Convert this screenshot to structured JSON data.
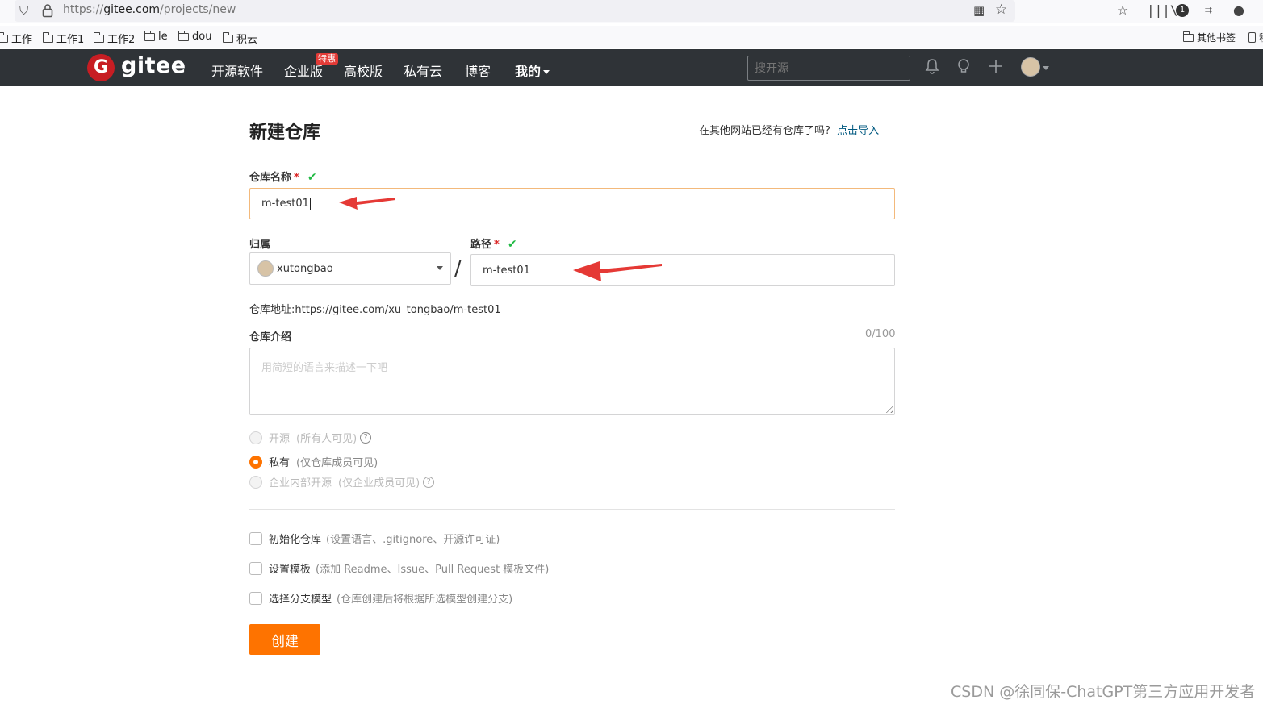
{
  "browser": {
    "url_prefix": "https://",
    "url_host": "gitee.com",
    "url_path": "/projects/new",
    "bookmarks": [
      "工作",
      "工作1",
      "工作2",
      "le",
      "dou",
      "积云"
    ],
    "other_bookmarks": "其他书签",
    "mobile_bookmarks": "移"
  },
  "navbar": {
    "logo_letter": "G",
    "logo_text": "gitee",
    "items": [
      "开源软件",
      "企业版",
      "高校版",
      "私有云",
      "博客",
      "我的"
    ],
    "enterprise_badge": "特惠",
    "search_placeholder": "搜开源"
  },
  "page": {
    "title": "新建仓库",
    "import_question": "在其他网站已经有仓库了吗?",
    "import_link": "点击导入"
  },
  "form": {
    "name_label": "仓库名称",
    "required_mark": "*",
    "check_mark": "✔",
    "name_value": "m-test01",
    "owner_label": "归属",
    "owner_value": "xutongbao",
    "separator": "/",
    "path_label": "路径",
    "path_value": "m-test01",
    "address_label": "仓库地址:",
    "address_value": "https://gitee.com/xu_tongbao/m-test01",
    "intro_label": "仓库介绍",
    "intro_counter": "0/100",
    "intro_placeholder": "用简短的语言来描述一下吧",
    "visibility": [
      {
        "label": "开源",
        "hint": "(所有人可见)",
        "checked": false,
        "disabled": true
      },
      {
        "label": "私有",
        "hint": "(仅仓库成员可见)",
        "checked": true,
        "disabled": false
      },
      {
        "label": "企业内部开源",
        "hint": "(仅企业成员可见)",
        "checked": false,
        "disabled": true
      }
    ],
    "options": [
      {
        "label": "初始化仓库",
        "hint": "(设置语言、.gitignore、开源许可证)"
      },
      {
        "label": "设置模板",
        "hint": "(添加 Readme、Issue、Pull Request 模板文件)"
      },
      {
        "label": "选择分支模型",
        "hint": "(仓库创建后将根据所选模型创建分支)"
      }
    ],
    "create_button": "创建"
  },
  "colors": {
    "nav_bg": "#2f3337",
    "brand_red": "#c71d23",
    "accent_orange": "#fe7300",
    "link_blue": "#005980",
    "annotation_arrow": "#e53935"
  },
  "watermark": "CSDN @徐同保-ChatGPT第三方应用开发者"
}
